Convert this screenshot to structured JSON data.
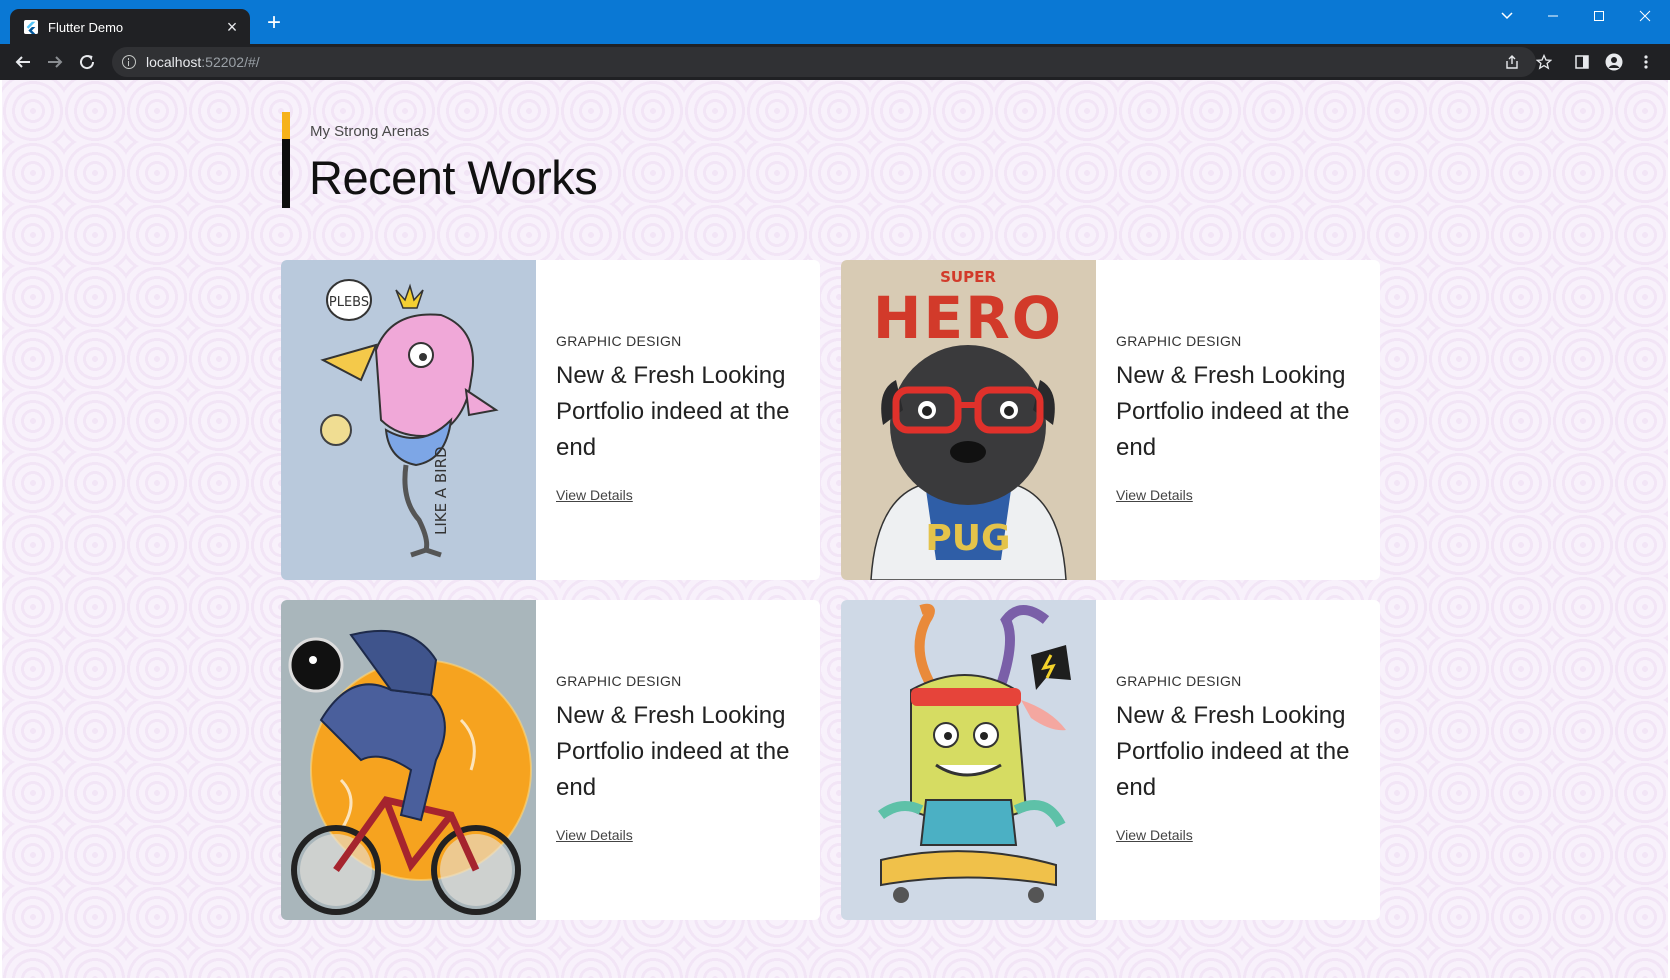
{
  "browser": {
    "tab_title": "Flutter Demo",
    "url_host": "localhost",
    "url_rest": ":52202/#/",
    "accent_color": "#0a78d4"
  },
  "section": {
    "subtitle": "My Strong Arenas",
    "title": "Recent Works",
    "bar_colors": [
      "#f6b21a",
      "#0d0d0d"
    ]
  },
  "works": [
    {
      "category": "GRAPHIC DESIGN",
      "title": "New & Fresh Looking Portfolio indeed at the end",
      "link": "View Details",
      "image": "bird-illustration",
      "image_text": [
        "PLEBS",
        "LIKE A BIRD"
      ],
      "image_bg": "#b9c9dc"
    },
    {
      "category": "GRAPHIC DESIGN",
      "title": "New & Fresh Looking Portfolio indeed at the end",
      "link": "View Details",
      "image": "pug-superhero-illustration",
      "image_text": [
        "SUPER",
        "HERO",
        "PUG"
      ],
      "image_bg": "#d8cbb4"
    },
    {
      "category": "GRAPHIC DESIGN",
      "title": "New & Fresh Looking Portfolio indeed at the end",
      "link": "View Details",
      "image": "astronaut-bike-illustration",
      "image_bg": "#a9b6bb"
    },
    {
      "category": "GRAPHIC DESIGN",
      "title": "New & Fresh Looking Portfolio indeed at the end",
      "link": "View Details",
      "image": "monster-skateboard-illustration",
      "image_bg": "#cfd9e6"
    }
  ]
}
